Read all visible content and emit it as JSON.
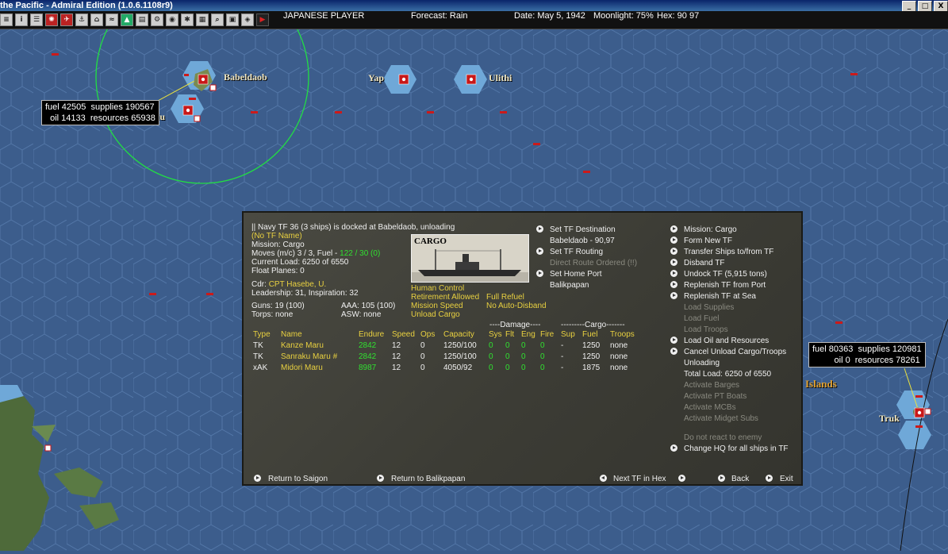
{
  "window": {
    "title": "the Pacific - Admiral Edition (1.0.6.1108r9)",
    "buttons": [
      "_",
      "□",
      "X"
    ]
  },
  "toolbar": {
    "player": "JAPANESE PLAYER",
    "forecast": "Forecast: Rain",
    "date": "Date: May 5, 1942",
    "moonlight": "Moonlight: 75%",
    "hex": "Hex: 90 97"
  },
  "map": {
    "labels": {
      "babeldaob": "Babeldaob",
      "yap": "Yap",
      "ulithi": "Ulithi",
      "peleliu": "leliu",
      "islands": "Islands",
      "truk": "Truk"
    },
    "tooltips": {
      "babeldaob": "fuel 42505  supplies 190567\n  oil 14133  resources 65938",
      "truk": "fuel 80363  supplies 120981\n         oil 0  resources 78261"
    }
  },
  "panel": {
    "header": "|| Navy TF 36 (3 ships) is docked at Babeldaob, unloading",
    "tf_name": "(No TF Name)",
    "mission": "Mission: Cargo",
    "moves_prefix": "Moves (m/c)  3 / 3, Fuel - ",
    "moves_fuel": "122 / 30 (0)",
    "current_load": "Current Load: 6250 of 6550",
    "float_planes": "Float Planes: 0",
    "cdr_label": "Cdr:",
    "cdr_name": "CPT  Hasebe, U.",
    "leadership": "Leadership: 31, Inspiration: 32",
    "guns": "Guns: 19 (100)",
    "aaa": "AAA: 105 (100)",
    "torps": "Torps: none",
    "asw": "ASW: none",
    "image_label": "CARGO",
    "controls_left": [
      "Human Control",
      "Retirement Allowed",
      "Mission Speed",
      "Unload Cargo"
    ],
    "controls_right": [
      "Full Refuel",
      "No Auto-Disband"
    ],
    "middle": {
      "set_destination": "Set TF Destination",
      "destination": "Babeldaob - 90,97",
      "set_routing": "Set TF Routing",
      "direct_route": "Direct Route Ordered (!!)",
      "set_home": "Set Home Port",
      "home": "Balikpapan"
    },
    "menu": [
      {
        "label": "Mission: Cargo",
        "arrow": true,
        "dim": false
      },
      {
        "label": "Form New TF",
        "arrow": true,
        "dim": false
      },
      {
        "label": "Transfer Ships to/from TF",
        "arrow": true,
        "dim": false
      },
      {
        "label": "Disband TF",
        "arrow": true,
        "dim": false
      },
      {
        "label": "Undock TF (5,915 tons)",
        "arrow": true,
        "dim": false
      },
      {
        "label": "Replenish TF from Port",
        "arrow": true,
        "dim": false
      },
      {
        "label": "Replenish TF at Sea",
        "arrow": true,
        "dim": false
      },
      {
        "label": "Load Supplies",
        "arrow": false,
        "dim": true
      },
      {
        "label": "Load Fuel",
        "arrow": false,
        "dim": true
      },
      {
        "label": "Load Troops",
        "arrow": false,
        "dim": true
      },
      {
        "label": "Load Oil and Resources",
        "arrow": true,
        "dim": false
      },
      {
        "label": "Cancel Unload Cargo/Troops",
        "arrow": true,
        "dim": false
      },
      {
        "label": "Unloading",
        "arrow": false,
        "dim": false
      },
      {
        "label": "Total Load: 6250 of 6550",
        "arrow": false,
        "dim": false
      },
      {
        "label": "Activate Barges",
        "arrow": false,
        "dim": true
      },
      {
        "label": "Activate PT Boats",
        "arrow": false,
        "dim": true
      },
      {
        "label": "Activate MCBs",
        "arrow": false,
        "dim": true
      },
      {
        "label": "Activate Midget Subs",
        "arrow": false,
        "dim": true
      }
    ],
    "menu_bottom": [
      {
        "label": "Do not react to enemy",
        "arrow": false,
        "dim": true
      },
      {
        "label": "Change HQ for all ships in TF",
        "arrow": true,
        "dim": false
      }
    ],
    "damage_group": "----Damage----",
    "cargo_group": "---------Cargo-------",
    "table_headers": [
      "Type",
      "Name",
      "Endure",
      "Speed",
      "Ops",
      "Capacity",
      "Sys",
      "Flt",
      "Eng",
      "Fire",
      "Sup",
      "Fuel",
      "Troops"
    ],
    "rows": [
      [
        "TK",
        "Kanze Maru",
        "2842",
        "12",
        "0",
        "1250/100",
        "0",
        "0",
        "0",
        "0",
        "-",
        "1250",
        "none"
      ],
      [
        "TK",
        "Sanraku Maru #",
        "2842",
        "12",
        "0",
        "1250/100",
        "0",
        "0",
        "0",
        "0",
        "-",
        "1250",
        "none"
      ],
      [
        "xAK",
        "Midori Maru",
        "8987",
        "12",
        "0",
        "4050/92",
        "0",
        "0",
        "0",
        "0",
        "-",
        "1875",
        "none"
      ]
    ],
    "bottom": {
      "return_saigon": "Return to Saigon",
      "return_balikpapan": "Return to Balikpapan",
      "next_tf": "Next TF in Hex",
      "back": "Back",
      "exit": "Exit"
    }
  }
}
